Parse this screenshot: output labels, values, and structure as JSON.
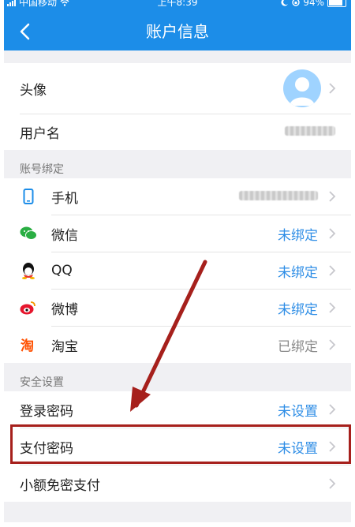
{
  "status_bar": {
    "carrier": "中国移动",
    "time": "上午8:39",
    "battery": "94%"
  },
  "nav": {
    "title": "账户信息"
  },
  "profile": [
    {
      "label": "头像",
      "type": "avatar"
    },
    {
      "label": "用户名",
      "value_obscured": true
    }
  ],
  "binding_section": {
    "title": "账号绑定",
    "items": [
      {
        "icon": "phone-icon",
        "label": "手机",
        "value_obscured": true
      },
      {
        "icon": "wechat-icon",
        "label": "微信",
        "value": "未绑定",
        "value_color": "#2f8ee6"
      },
      {
        "icon": "qq-icon",
        "label": "QQ",
        "value": "未绑定",
        "value_color": "#2f8ee6"
      },
      {
        "icon": "weibo-icon",
        "label": "微博",
        "value": "未绑定",
        "value_color": "#2f8ee6"
      },
      {
        "icon": "taobao-icon",
        "label": "淘宝",
        "value": "已绑定",
        "value_color": "#8a8a8a"
      }
    ]
  },
  "security_section": {
    "title": "安全设置",
    "items": [
      {
        "label": "登录密码",
        "value": "未设置"
      },
      {
        "label": "支付密码",
        "value": "未设置",
        "highlighted": true
      },
      {
        "label": "小额免密支付",
        "value": ""
      }
    ]
  },
  "colors": {
    "header_bg": "#1c8de8",
    "link_blue": "#2f8ee6",
    "annotation_red": "#a6201c"
  }
}
